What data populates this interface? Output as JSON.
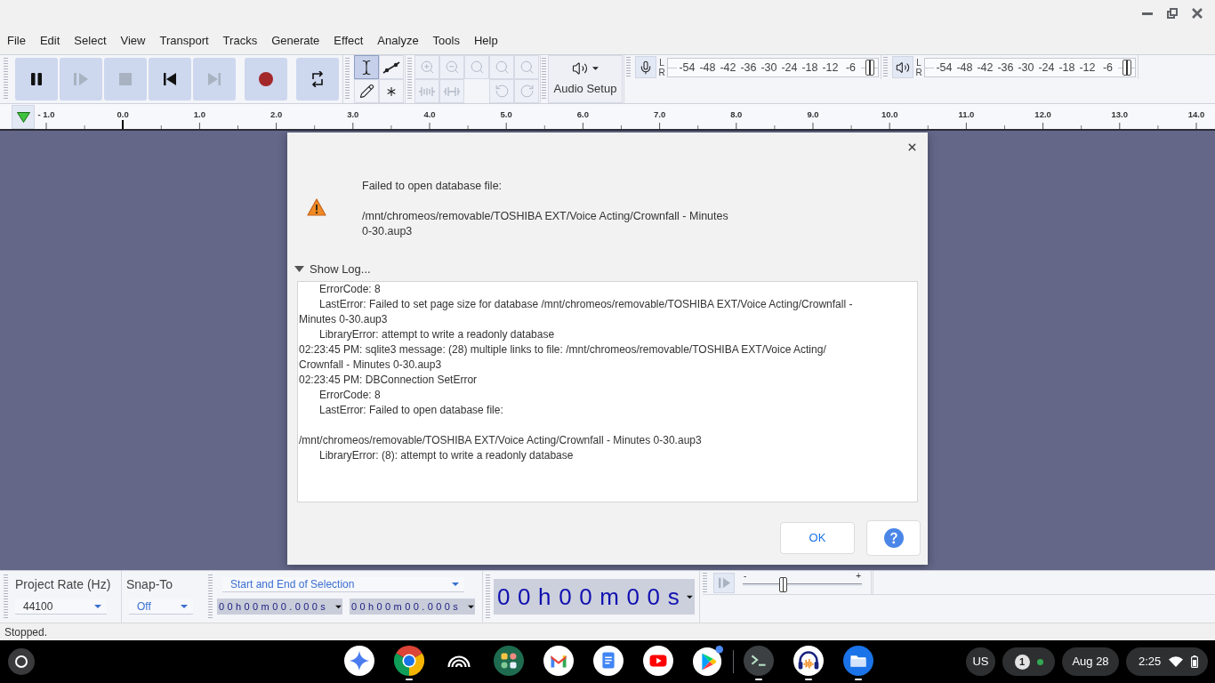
{
  "menu_bar": [
    "File",
    "Edit",
    "Select",
    "View",
    "Transport",
    "Tracks",
    "Generate",
    "Effect",
    "Analyze",
    "Tools",
    "Help"
  ],
  "transport_buttons": [
    {
      "disabled": false
    },
    {
      "disabled": true
    },
    {
      "disabled": true
    },
    {
      "disabled": false
    },
    {
      "disabled": true
    },
    {
      "disabled": false
    },
    {
      "disabled": false
    }
  ],
  "tools": [
    {
      "selected": true
    },
    {
      "selected": false
    },
    {
      "selected": false
    },
    {
      "selected": false
    }
  ],
  "edit_buttons": [
    {
      "disabled": true
    },
    {
      "disabled": true
    },
    {
      "disabled": true
    },
    {
      "disabled": true
    },
    {
      "disabled": true
    },
    {
      "disabled": true
    },
    {
      "disabled": true
    },
    {
      "disabled": true
    },
    {
      "disabled": true
    }
  ],
  "audio_setup": {
    "label": "Audio Setup"
  },
  "recording_meter": {
    "channels": [
      "L",
      "R"
    ],
    "scale": [
      "-54",
      "-48",
      "-42",
      "-36",
      "-30",
      "-24",
      "-18",
      "-12",
      "-6"
    ],
    "level": 1
  },
  "playback_meter": {
    "channels": [
      "L",
      "R"
    ],
    "scale": [
      "-54",
      "-48",
      "-42",
      "-36",
      "-30",
      "-24",
      "-18",
      "-12",
      "-6"
    ],
    "level": 1
  },
  "ruler": {
    "labels": [
      "- 1.0",
      "0.0",
      "1.0",
      "2.0",
      "3.0",
      "4.0",
      "5.0",
      "6.0",
      "7.0",
      "8.0",
      "9.0",
      "10.0",
      "11.0",
      "12.0",
      "13.0",
      "14.0"
    ]
  },
  "dialog": {
    "message": [
      "Failed to open database file:",
      "/mnt/chromeos/removable/TOSHIBA EXT/Voice Acting/Crownfall - Minutes 0-30.aup3"
    ],
    "log_toggle": {
      "label": "Show Log...",
      "expanded": true
    },
    "log_blocks": [
      {
        "lines": [
          {
            "text": "ErrorCode: 8",
            "indented": true
          },
          {
            "text": "LastError: Failed to set page size for database /mnt/chromeos/removable/TOSHIBA EXT/Voice Acting/Crownfall -",
            "indented": true
          },
          {
            "text": "Minutes 0-30.aup3",
            "indented": false
          },
          {
            "text": "LibraryError: attempt to write a readonly database",
            "indented": true
          },
          {
            "text": "02:23:45 PM: sqlite3 message: (28) multiple links to file: /mnt/chromeos/removable/TOSHIBA EXT/Voice Acting/",
            "indented": false
          },
          {
            "text": "Crownfall - Minutes 0-30.aup3",
            "indented": false
          },
          {
            "text": "02:23:45 PM: DBConnection SetError",
            "indented": false
          },
          {
            "text": "ErrorCode: 8",
            "indented": true
          },
          {
            "text": "LastError: Failed to open database file:",
            "indented": true
          }
        ]
      },
      {
        "lines": [
          {
            "text": "/mnt/chromeos/removable/TOSHIBA EXT/Voice Acting/Crownfall - Minutes 0-30.aup3",
            "indented": false
          },
          {
            "text": "LibraryError: (8): attempt to write a readonly database",
            "indented": true
          }
        ]
      }
    ],
    "ok_button": "OK"
  },
  "selection_toolbar": {
    "project_rate": {
      "label": "Project Rate (Hz)",
      "value": "44100"
    },
    "snap_to": {
      "label": "Snap-To",
      "value": "Off"
    },
    "selection_mode": "Start and End of Selection",
    "start": "00h00m00.000s",
    "end": "00h00m00.000s"
  },
  "time_toolbar": {
    "value": "00h00m00s"
  },
  "play_at_speed": {
    "play_disabled": true,
    "min_label": "-",
    "max_label": "+",
    "level": 0.33
  },
  "status_bar": {
    "text": "Stopped."
  },
  "shelf": {
    "apps": [
      {
        "running": false
      },
      {
        "running": true
      },
      {
        "running": false
      },
      {
        "running": false
      },
      {
        "running": false
      },
      {
        "running": false
      },
      {
        "running": false
      },
      {
        "running": false
      },
      {
        "running": true
      },
      {
        "running": true
      },
      {
        "running": true
      }
    ],
    "language": "US",
    "notification_count": "1",
    "date": "Aug 28",
    "time": "2:25"
  }
}
